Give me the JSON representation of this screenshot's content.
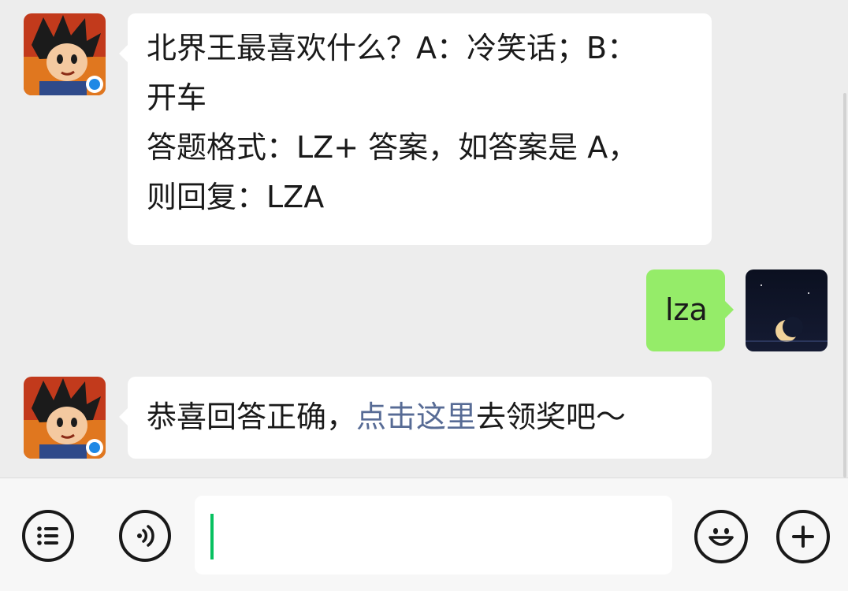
{
  "messages": [
    {
      "side": "left",
      "sender_avatar": "game-character-avatar",
      "lines": [
        "北界王最喜欢什么？A：冷笑话；B：",
        "开车",
        "答题格式：LZ+ 答案，如答案是 A，",
        "则回复：LZA"
      ]
    },
    {
      "side": "right",
      "sender_avatar": "moon-night-avatar",
      "text": "lza"
    },
    {
      "side": "left",
      "sender_avatar": "game-character-avatar",
      "prefix": "恭喜回答正确，",
      "link_text": "点击这里",
      "suffix": "去领奖吧～"
    }
  ],
  "input_bar": {
    "left_icons": [
      "list-menu-icon",
      "voice-icon"
    ],
    "right_icons": [
      "emoji-icon",
      "plus-icon"
    ],
    "input_value": ""
  },
  "colors": {
    "background": "#ededed",
    "bubble_incoming": "#ffffff",
    "bubble_outgoing": "#95ec69",
    "link": "#576b95",
    "caret": "#07c160"
  }
}
